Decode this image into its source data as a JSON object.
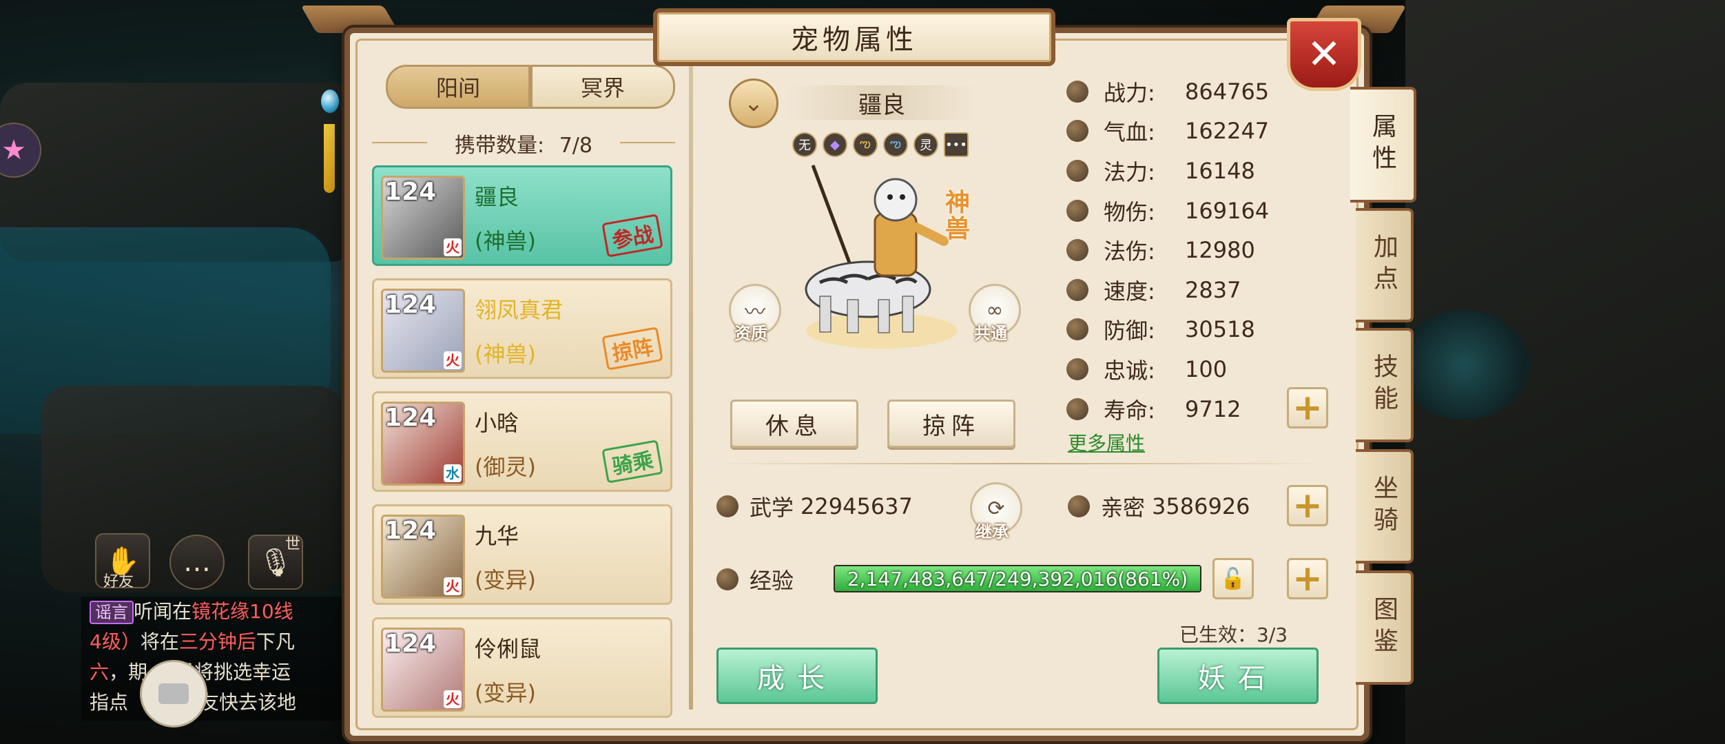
{
  "window": {
    "title": "宠物属性"
  },
  "realm_tabs": [
    {
      "label": "阳间"
    },
    {
      "label": "冥界"
    }
  ],
  "carry": {
    "label": "携带数量:",
    "count": "7/8"
  },
  "pets": [
    {
      "level": "124",
      "name": "疆良",
      "type": "(神兽)",
      "element": "火",
      "status": "参战"
    },
    {
      "level": "124",
      "name": "翎凤真君",
      "type": "(神兽)",
      "element": "火",
      "status": "掠阵"
    },
    {
      "level": "124",
      "name": "小晗",
      "type": "(御灵)",
      "element": "水",
      "status": "骑乘"
    },
    {
      "level": "124",
      "name": "九华",
      "type": "(变异)",
      "element": "火",
      "status": ""
    },
    {
      "level": "124",
      "name": "伶俐鼠",
      "type": "(变异)",
      "element": "火",
      "status": ""
    }
  ],
  "selected_pet": {
    "name": "疆良",
    "grade_mark": "神兽",
    "skill_icons": [
      "无",
      "◆",
      "ఌ",
      "ఌ",
      "灵",
      "•••"
    ]
  },
  "center_buttons": {
    "quality": "资质",
    "common": "共通",
    "rest": "休息",
    "lineup": "掠阵",
    "inherit": "继承"
  },
  "stats": [
    {
      "label": "战力:",
      "value": "864765"
    },
    {
      "label": "气血:",
      "value": "162247"
    },
    {
      "label": "法力:",
      "value": "16148"
    },
    {
      "label": "物伤:",
      "value": "169164"
    },
    {
      "label": "法伤:",
      "value": "12980"
    },
    {
      "label": "速度:",
      "value": "2837"
    },
    {
      "label": "防御:",
      "value": "30518"
    },
    {
      "label": "忠诚:",
      "value": "100"
    },
    {
      "label": "寿命:",
      "value": "9712"
    }
  ],
  "more_attrs": "更多属性",
  "martial": {
    "label": "武学",
    "value": "22945637"
  },
  "intimacy": {
    "label": "亲密",
    "value": "3586926"
  },
  "exp": {
    "label": "经验",
    "text": "2,147,483,647/249,392,016(861%)",
    "fill": 1.0
  },
  "effective": "已生效：3/3",
  "bottom_buttons": {
    "grow": "成长",
    "stone": "妖石"
  },
  "side_tabs": [
    {
      "label": "属性",
      "active": true
    },
    {
      "label": "加点",
      "active": false
    },
    {
      "label": "技能",
      "active": false
    },
    {
      "label": "坐骑",
      "active": false
    },
    {
      "label": "图鉴",
      "active": false
    }
  ],
  "hud": {
    "friend_label": "好友",
    "voice_tag": "世",
    "chat": {
      "tag": "谣言",
      "l1a": "听闻在",
      "l1b": "镜花缘10线",
      "l2a": "4级）",
      "l2b": "将在",
      "l2c": "三分钟后",
      "l2d": "下凡",
      "l3a": "六",
      "l3b": "，期",
      "l3c": "君将挑选幸运",
      "l4a": "指点",
      "l4b": "道友快去该地"
    }
  }
}
